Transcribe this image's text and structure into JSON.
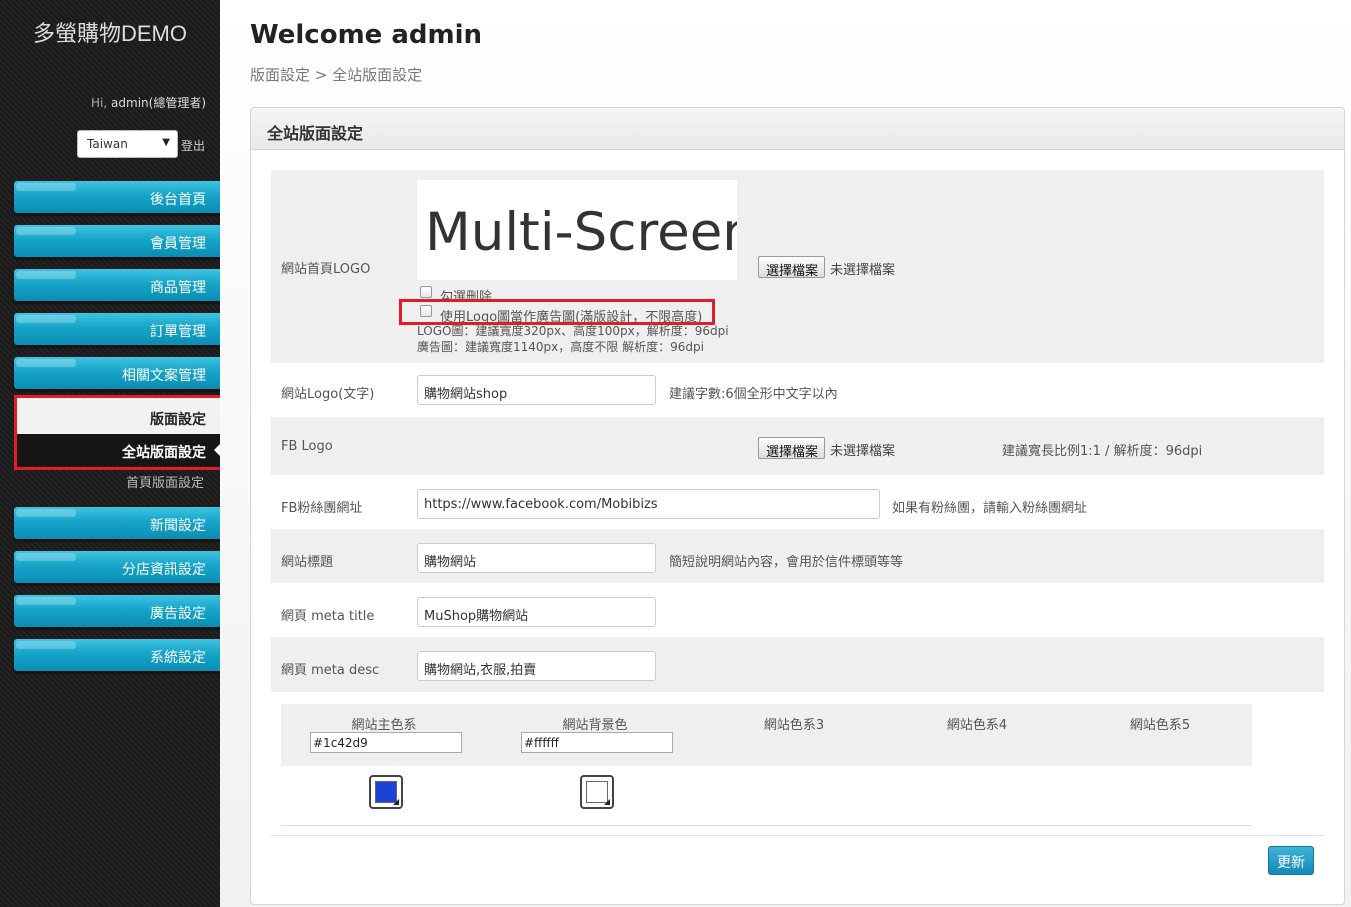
{
  "sidebar": {
    "brand": "多螢購物DEMO",
    "greeting_prefix": "Hi, ",
    "greeting_user": "admin(總管理者)",
    "language": "Taiwan",
    "logout": "登出",
    "menu": [
      "後台首頁",
      "會員管理",
      "商品管理",
      "訂單管理",
      "相關文案管理"
    ],
    "submenu_header": "版面設定",
    "submenu_active": "全站版面設定",
    "submenu_other": "首頁版面設定",
    "menu2": [
      "新聞設定",
      "分店資訊設定",
      "廣告設定",
      "系統設定"
    ]
  },
  "header": {
    "welcome": "Welcome admin",
    "breadcrumb": "版面設定 > 全站版面設定"
  },
  "panel": {
    "title": "全站版面設定",
    "logo": {
      "label": "網站首頁LOGO",
      "image_text": "Multi-Screen",
      "file_button": "選擇檔案",
      "file_status": "未選擇檔案",
      "delete_checkbox": "勾選刪除",
      "banner_checkbox": "使用Logo圖當作廣告圖(滿版設計，不限高度)",
      "note1": "LOGO圖：建議寬度320px、高度100px，解析度：96dpi",
      "note2": "廣告圖：建議寬度1140px，高度不限 解析度：96dpi"
    },
    "logo_text": {
      "label": "網站Logo(文字)",
      "value": "購物網站shop",
      "hint": "建議字數:6個全形中文字以內"
    },
    "fb_logo": {
      "label": "FB Logo",
      "file_button": "選擇檔案",
      "file_status": "未選擇檔案",
      "hint": "建議寬長比例1:1 / 解析度：96dpi"
    },
    "fb_page": {
      "label": "FB粉絲團網址",
      "value": "https://www.facebook.com/Mobibizs",
      "hint": "如果有粉絲團，請輸入粉絲團網址"
    },
    "site_title": {
      "label": "網站標題",
      "value": "購物網站",
      "hint": "簡短說明網站內容，會用於信件標頭等等"
    },
    "meta_title": {
      "label": "網頁 meta title",
      "value": "MuShop購物網站"
    },
    "meta_desc": {
      "label": "網頁 meta desc",
      "value": "購物網站,衣服,拍賣"
    },
    "colors": {
      "main_label": "網站主色系",
      "main_value": "#1c42d9",
      "bg_label": "網站背景色",
      "bg_value": "#ffffff",
      "c3_label": "網站色系3",
      "c4_label": "網站色系4",
      "c5_label": "網站色系5"
    },
    "update_button": "更新"
  },
  "theme": {
    "accent": "#16a5c9",
    "highlight_box": "#e21d2a",
    "main_color_swatch": "#1c42d9",
    "bg_color_swatch": "#ffffff"
  }
}
